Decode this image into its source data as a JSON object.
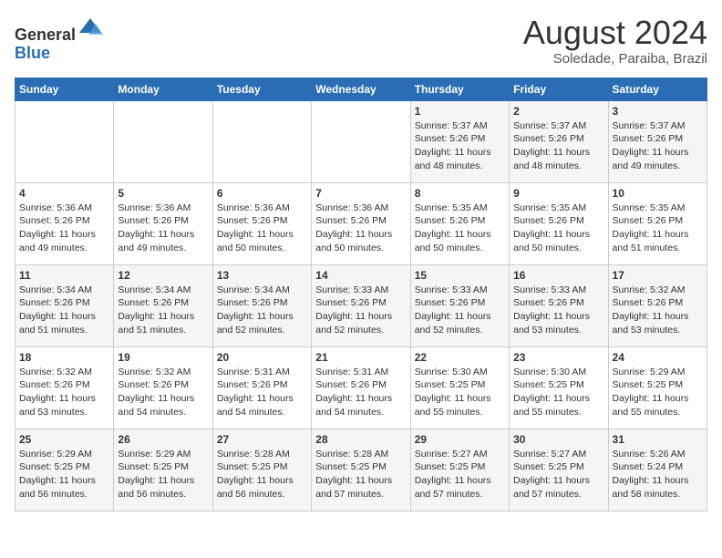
{
  "header": {
    "logo_line1": "General",
    "logo_line2": "Blue",
    "month_year": "August 2024",
    "location": "Soledade, Paraiba, Brazil"
  },
  "days_of_week": [
    "Sunday",
    "Monday",
    "Tuesday",
    "Wednesday",
    "Thursday",
    "Friday",
    "Saturday"
  ],
  "weeks": [
    [
      {
        "day": "",
        "info": ""
      },
      {
        "day": "",
        "info": ""
      },
      {
        "day": "",
        "info": ""
      },
      {
        "day": "",
        "info": ""
      },
      {
        "day": "1",
        "info": "Sunrise: 5:37 AM\nSunset: 5:26 PM\nDaylight: 11 hours and 48 minutes."
      },
      {
        "day": "2",
        "info": "Sunrise: 5:37 AM\nSunset: 5:26 PM\nDaylight: 11 hours and 48 minutes."
      },
      {
        "day": "3",
        "info": "Sunrise: 5:37 AM\nSunset: 5:26 PM\nDaylight: 11 hours and 49 minutes."
      }
    ],
    [
      {
        "day": "4",
        "info": "Sunrise: 5:36 AM\nSunset: 5:26 PM\nDaylight: 11 hours and 49 minutes."
      },
      {
        "day": "5",
        "info": "Sunrise: 5:36 AM\nSunset: 5:26 PM\nDaylight: 11 hours and 49 minutes."
      },
      {
        "day": "6",
        "info": "Sunrise: 5:36 AM\nSunset: 5:26 PM\nDaylight: 11 hours and 50 minutes."
      },
      {
        "day": "7",
        "info": "Sunrise: 5:36 AM\nSunset: 5:26 PM\nDaylight: 11 hours and 50 minutes."
      },
      {
        "day": "8",
        "info": "Sunrise: 5:35 AM\nSunset: 5:26 PM\nDaylight: 11 hours and 50 minutes."
      },
      {
        "day": "9",
        "info": "Sunrise: 5:35 AM\nSunset: 5:26 PM\nDaylight: 11 hours and 50 minutes."
      },
      {
        "day": "10",
        "info": "Sunrise: 5:35 AM\nSunset: 5:26 PM\nDaylight: 11 hours and 51 minutes."
      }
    ],
    [
      {
        "day": "11",
        "info": "Sunrise: 5:34 AM\nSunset: 5:26 PM\nDaylight: 11 hours and 51 minutes."
      },
      {
        "day": "12",
        "info": "Sunrise: 5:34 AM\nSunset: 5:26 PM\nDaylight: 11 hours and 51 minutes."
      },
      {
        "day": "13",
        "info": "Sunrise: 5:34 AM\nSunset: 5:26 PM\nDaylight: 11 hours and 52 minutes."
      },
      {
        "day": "14",
        "info": "Sunrise: 5:33 AM\nSunset: 5:26 PM\nDaylight: 11 hours and 52 minutes."
      },
      {
        "day": "15",
        "info": "Sunrise: 5:33 AM\nSunset: 5:26 PM\nDaylight: 11 hours and 52 minutes."
      },
      {
        "day": "16",
        "info": "Sunrise: 5:33 AM\nSunset: 5:26 PM\nDaylight: 11 hours and 53 minutes."
      },
      {
        "day": "17",
        "info": "Sunrise: 5:32 AM\nSunset: 5:26 PM\nDaylight: 11 hours and 53 minutes."
      }
    ],
    [
      {
        "day": "18",
        "info": "Sunrise: 5:32 AM\nSunset: 5:26 PM\nDaylight: 11 hours and 53 minutes."
      },
      {
        "day": "19",
        "info": "Sunrise: 5:32 AM\nSunset: 5:26 PM\nDaylight: 11 hours and 54 minutes."
      },
      {
        "day": "20",
        "info": "Sunrise: 5:31 AM\nSunset: 5:26 PM\nDaylight: 11 hours and 54 minutes."
      },
      {
        "day": "21",
        "info": "Sunrise: 5:31 AM\nSunset: 5:26 PM\nDaylight: 11 hours and 54 minutes."
      },
      {
        "day": "22",
        "info": "Sunrise: 5:30 AM\nSunset: 5:25 PM\nDaylight: 11 hours and 55 minutes."
      },
      {
        "day": "23",
        "info": "Sunrise: 5:30 AM\nSunset: 5:25 PM\nDaylight: 11 hours and 55 minutes."
      },
      {
        "day": "24",
        "info": "Sunrise: 5:29 AM\nSunset: 5:25 PM\nDaylight: 11 hours and 55 minutes."
      }
    ],
    [
      {
        "day": "25",
        "info": "Sunrise: 5:29 AM\nSunset: 5:25 PM\nDaylight: 11 hours and 56 minutes."
      },
      {
        "day": "26",
        "info": "Sunrise: 5:29 AM\nSunset: 5:25 PM\nDaylight: 11 hours and 56 minutes."
      },
      {
        "day": "27",
        "info": "Sunrise: 5:28 AM\nSunset: 5:25 PM\nDaylight: 11 hours and 56 minutes."
      },
      {
        "day": "28",
        "info": "Sunrise: 5:28 AM\nSunset: 5:25 PM\nDaylight: 11 hours and 57 minutes."
      },
      {
        "day": "29",
        "info": "Sunrise: 5:27 AM\nSunset: 5:25 PM\nDaylight: 11 hours and 57 minutes."
      },
      {
        "day": "30",
        "info": "Sunrise: 5:27 AM\nSunset: 5:25 PM\nDaylight: 11 hours and 57 minutes."
      },
      {
        "day": "31",
        "info": "Sunrise: 5:26 AM\nSunset: 5:24 PM\nDaylight: 11 hours and 58 minutes."
      }
    ]
  ]
}
